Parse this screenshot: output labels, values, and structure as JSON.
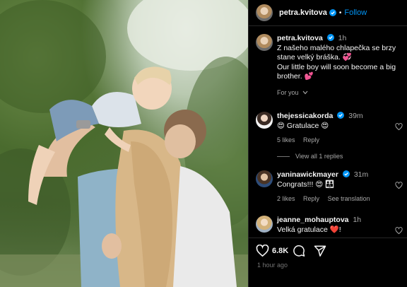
{
  "post": {
    "username": "petra.kvitova",
    "follow_label": "Follow",
    "dot": "•",
    "caption": {
      "username": "petra.kvitova",
      "time": "1h",
      "line1": "Z našeho malého chlapečka se brzy stane velký bráška. 💞",
      "line2": "Our little boy will soon become a big brother. 💕",
      "translate_label": "For you"
    },
    "likes": "6.8K",
    "posted_ago": "1 hour ago"
  },
  "comments": [
    {
      "username": "thejessicakorda",
      "time": "39m",
      "text": "😍 Gratulace 😍",
      "likes": "5 likes",
      "reply": "Reply",
      "view_replies": "View all 1 replies"
    },
    {
      "username": "yaninawickmayer",
      "time": "31m",
      "text": "Congrats!!! 😍 👪",
      "likes": "2 likes",
      "reply": "Reply",
      "see_translation": "See translation"
    },
    {
      "username": "jeanne_mohauptova",
      "time": "1h",
      "text": "Velká gratulace ❤️!"
    }
  ],
  "icons": [
    "verified-badge-icon",
    "heart-icon",
    "comment-icon",
    "share-icon",
    "chevron-down-icon"
  ],
  "colors": {
    "accent": "#0095f6",
    "background": "#000000",
    "secondary_text": "#a8a8a8"
  }
}
